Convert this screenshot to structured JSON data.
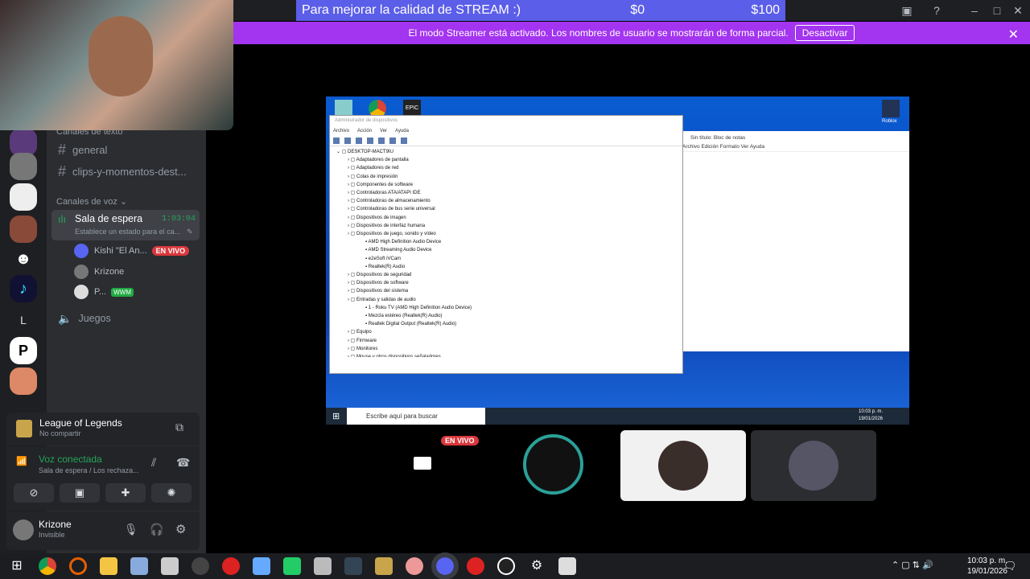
{
  "donation": {
    "goal_text": "Para mejorar la calidad de STREAM :)",
    "current": "$0",
    "target": "$100"
  },
  "banner": {
    "text": "El modo Streamer está activado. Los nombres de usuario se mostrarán de forma parcial.",
    "button": "Desactivar"
  },
  "channels": {
    "text_category": "Canales de texto",
    "text_channels": [
      "general",
      "clips-y-momentos-dest..."
    ],
    "voice_category": "Canales de voz",
    "voice_channel": {
      "name": "Sala de espera",
      "timer": "1:03:04",
      "status": "Establece un estado para el ca..."
    },
    "voice_users": [
      {
        "name": "Kishi \"El An...",
        "badge": "EN VIVO"
      },
      {
        "name": "Krizone",
        "badge": ""
      },
      {
        "name": "P...",
        "badge": "WWM"
      }
    ],
    "other_voice": "Juegos"
  },
  "rail": {
    "letter_server": "L"
  },
  "game_panel": {
    "title": "League of Legends",
    "subtitle": "No compartir"
  },
  "voice_panel": {
    "title": "Voz conectada",
    "subtitle": "Sala de espera / Los rechaza..."
  },
  "user_panel": {
    "name": "Krizone",
    "status": "Invisible"
  },
  "devmgr": {
    "title": "Administrador de dispositivos",
    "menu": [
      "Archivo",
      "Acción",
      "Ver",
      "Ayuda"
    ],
    "root": "DESKTOP-MACT9IU",
    "items": [
      {
        "t": "Adaptadores de pantalla",
        "l": 1
      },
      {
        "t": "Adaptadores de red",
        "l": 1
      },
      {
        "t": "Colas de impresión",
        "l": 1
      },
      {
        "t": "Componentes de software",
        "l": 1
      },
      {
        "t": "Controladoras ATA/ATAPI IDE",
        "l": 1
      },
      {
        "t": "Controladoras de almacenamiento",
        "l": 1
      },
      {
        "t": "Controladoras de bus serie universal",
        "l": 1
      },
      {
        "t": "Dispositivos de imagen",
        "l": 1
      },
      {
        "t": "Dispositivos de interfaz humana",
        "l": 1
      },
      {
        "t": "Dispositivos de juego, sonido y vídeo",
        "l": 1
      },
      {
        "t": "AMD High Definition Audio Device",
        "l": 2
      },
      {
        "t": "AMD Streaming Audio Device",
        "l": 2
      },
      {
        "t": "e2eSoft iVCam",
        "l": 2
      },
      {
        "t": "Realtek(R) Audio",
        "l": 2
      },
      {
        "t": "Dispositivos de seguridad",
        "l": 1
      },
      {
        "t": "Dispositivos de software",
        "l": 1
      },
      {
        "t": "Dispositivos del sistema",
        "l": 1
      },
      {
        "t": "Entradas y salidas de audio",
        "l": 1
      },
      {
        "t": "1 - Roku TV (AMD High Definition Audio Device)",
        "l": 2
      },
      {
        "t": "Mezcla estéreo (Realtek(R) Audio)",
        "l": 2
      },
      {
        "t": "Realtek Digital Output (Realtek(R) Audio)",
        "l": 2
      },
      {
        "t": "Equipo",
        "l": 1
      },
      {
        "t": "Firmware",
        "l": 1
      },
      {
        "t": "Monitores",
        "l": 1
      },
      {
        "t": "Mouse y otros dispositivos señaladores",
        "l": 1
      }
    ]
  },
  "notepad": {
    "title": "Sin título: Bloc de notas",
    "menu": "Archivo Edición Formato Ver Ayuda"
  },
  "inner_taskbar": {
    "search": "Escribe aquí para buscar",
    "time": "10:03 p. m.",
    "date": "19/01/2026"
  },
  "desktop": {
    "roblox": "Roblox"
  },
  "tiles": {
    "live_badge": "EN VIVO"
  },
  "clock": {
    "time": "10:03 p. m.",
    "date": "19/01/2026"
  }
}
